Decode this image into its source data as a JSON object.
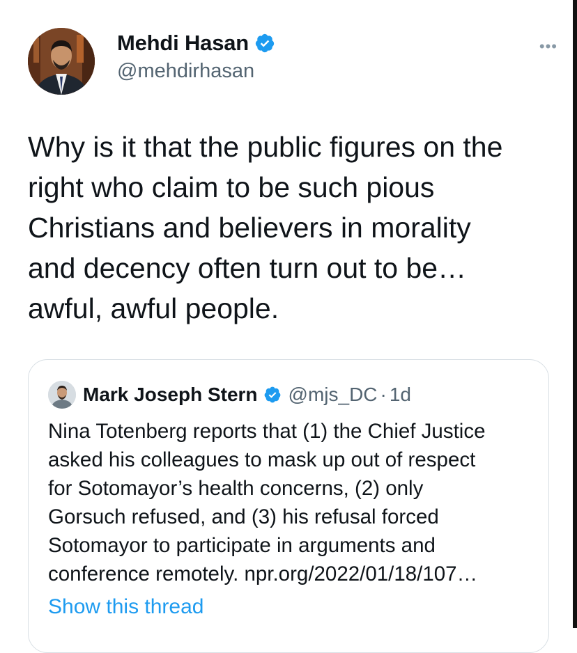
{
  "author": {
    "name": "Mehdi Hasan",
    "handle": "@mehdirhasan",
    "avatar_icon": "profile-photo",
    "verified_icon": "verified-badge-icon"
  },
  "more_label": "•••",
  "tweet": {
    "text": "Why is it that the public figures on the\nright who claim to be such pious\nChristians and believers in morality\nand decency often turn out to be…\nawful, awful people."
  },
  "quote": {
    "name": "Mark Joseph Stern",
    "handle": "@mjs_DC",
    "dot": "·",
    "time": "1d",
    "text": "Nina Totenberg reports that (1) the Chief Justice\nasked his colleagues to mask up out of respect\nfor Sotomayor’s health concerns, (2) only\nGorsuch refused, and (3) his refusal forced\nSotomayor to participate in arguments and\nconference remotely. npr.org/2022/01/18/107…",
    "show_thread": "Show this thread"
  },
  "colors": {
    "link": "#1d9bf0",
    "verified": "#1d9bf0",
    "secondary_text": "#536471"
  }
}
